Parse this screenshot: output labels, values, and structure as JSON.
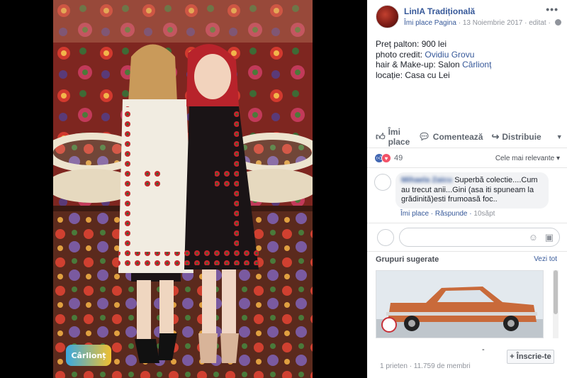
{
  "post": {
    "page_name": "LinIA Tradițională",
    "like_page": "Îmi place Pagina",
    "date": "13 Noiembrie 2017",
    "edited": "editat",
    "more": "•••",
    "text_lines": [
      {
        "prefix": "Preț palton: 900 lei",
        "link": ""
      },
      {
        "prefix": "photo credit: ",
        "link": "Ovidiu Grovu"
      },
      {
        "prefix": "hair & Make-up: Salon ",
        "link": "Cârlionț"
      },
      {
        "prefix": "locație: Casa cu Lei",
        "link": ""
      }
    ]
  },
  "actions": {
    "like": "Îmi place",
    "comment": "Comentează",
    "share": "Distribuie"
  },
  "reactions": {
    "count": "49",
    "sort_label": "Cele mai relevante ▾"
  },
  "comment": {
    "author": "Mihaela Zaicu",
    "text": "Superbă colectie....Cum au trecut anii...Gini (asa iti spuneam la grădinită)esti frumoasă foc..",
    "like": "Îmi place",
    "reply": "Răspunde",
    "time": "10săpt"
  },
  "groups": {
    "title": "Grupuri sugerate",
    "see_all": "Vezi tot",
    "group_name": "-",
    "join": "+ Înscrie-te",
    "meta": "1 prieten · 11.759 de membri"
  },
  "photo": {
    "watermark": "Cârlionț",
    "colors": {
      "carpet": "#8a2a22",
      "cream_coat": "#f1ece1",
      "black_coat": "#1a1416",
      "red_hair": "#b8232b"
    }
  }
}
